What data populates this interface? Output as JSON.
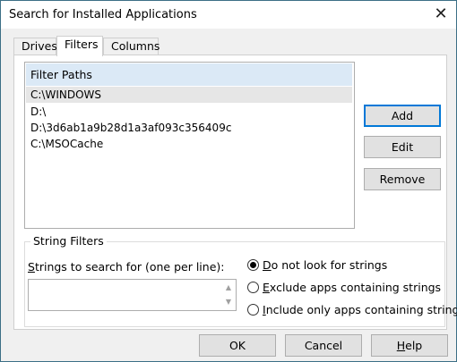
{
  "window": {
    "title": "Search for Installed Applications",
    "close_glyph": "✕"
  },
  "tabs": [
    {
      "label": "Drives"
    },
    {
      "label": "Filters"
    },
    {
      "label": "Columns"
    }
  ],
  "filter_paths": {
    "header": "Filter Paths",
    "items": [
      "C:\\WINDOWS",
      "D:\\",
      "D:\\3d6ab1a9b28d1a3af093c356409c",
      "C:\\MSOCache"
    ]
  },
  "side_buttons": {
    "add": "Add",
    "edit": "Edit",
    "remove": "Remove"
  },
  "string_filters": {
    "group_label": "String Filters",
    "input_label_prefix": "S",
    "input_label_rest": "trings to search for (one per line):",
    "input_value": "",
    "options": [
      {
        "underline": "D",
        "rest": "o not look for strings",
        "checked": true
      },
      {
        "underline": "E",
        "rest": "xclude apps containing strings",
        "checked": false
      },
      {
        "underline": "I",
        "rest": "nclude only apps containing strings",
        "checked": false
      }
    ]
  },
  "footer_buttons": {
    "ok": "OK",
    "cancel": "Cancel",
    "help_underline": "H",
    "help_rest": "elp"
  }
}
